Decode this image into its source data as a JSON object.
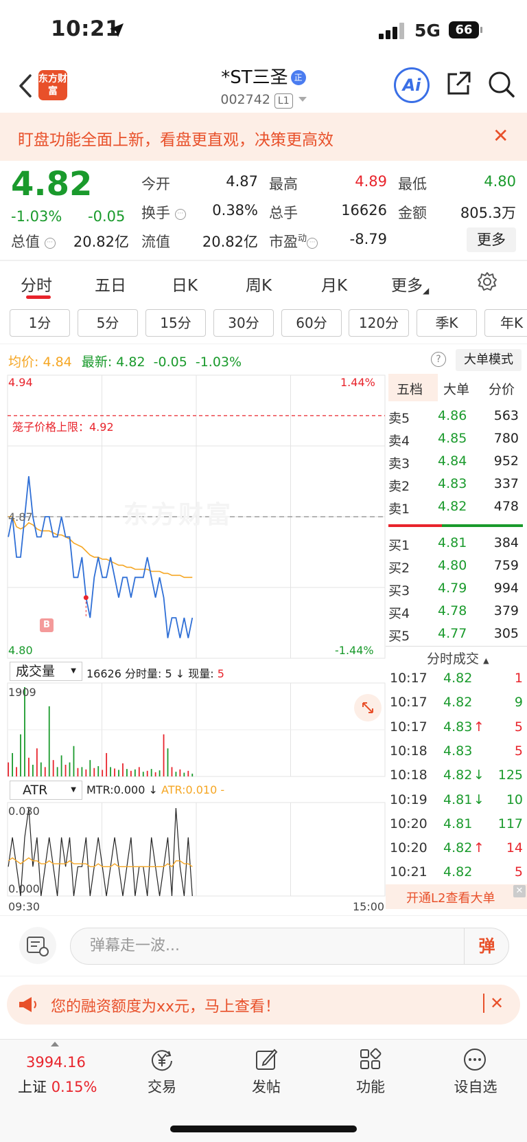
{
  "status_bar": {
    "time": "10:21",
    "network": "5G",
    "battery": "66"
  },
  "header": {
    "logo_text": "东方财富",
    "title": "*ST三圣",
    "title_badge": "正",
    "code": "002742",
    "level": "L1",
    "ai_label": "Ai"
  },
  "promo": {
    "text": "盯盘功能全面上新，看盘更直观，决策更高效",
    "close": "✕"
  },
  "quote": {
    "price": "4.82",
    "pct": "-1.03%",
    "change": "-0.05",
    "fields": [
      {
        "label": "今开",
        "value": "4.87",
        "color": "#222222"
      },
      {
        "label": "最高",
        "value": "4.89",
        "color": "#e8242c"
      },
      {
        "label": "最低",
        "value": "4.80",
        "color": "#1a9a2c"
      },
      {
        "label": "换手",
        "value": "0.38%",
        "color": "#222222"
      },
      {
        "label": "总手",
        "value": "16626",
        "color": "#222222"
      },
      {
        "label": "金额",
        "value": "805.3万",
        "color": "#222222"
      },
      {
        "label": "总值",
        "value": "20.82亿",
        "color": "#222222"
      },
      {
        "label": "流值",
        "value": "20.82亿",
        "color": "#222222"
      },
      {
        "label": "市盈",
        "value": "-8.79",
        "color": "#222222"
      }
    ],
    "pe_sup": "动",
    "more_label": "更多"
  },
  "tabs": [
    "分时",
    "五日",
    "日K",
    "周K",
    "月K",
    "更多"
  ],
  "periods": [
    "1分",
    "5分",
    "15分",
    "30分",
    "60分",
    "120分",
    "季K",
    "年K"
  ],
  "avg_bar": {
    "avg_label": "均价:",
    "avg_value": "4.84",
    "latest_label": "最新:",
    "latest_value": "4.82",
    "change": "-0.05",
    "pct": "-1.03%"
  },
  "big_order_label": "大单模式",
  "chart_data": {
    "type": "line",
    "price_high": "4.94",
    "price_low": "4.80",
    "pct_high": "1.44%",
    "pct_low": "-1.44%",
    "prev_close": "4.87",
    "limit_label": "笼子价格上限：4.92",
    "limit_value": 4.92,
    "ylim": [
      4.8,
      4.94
    ],
    "time_start": "09:30",
    "time_end": "15:00",
    "price": [
      4.86,
      4.87,
      4.85,
      4.85,
      4.87,
      4.89,
      4.87,
      4.86,
      4.86,
      4.87,
      4.87,
      4.86,
      4.86,
      4.87,
      4.86,
      4.86,
      4.84,
      4.84,
      4.85,
      4.83,
      4.82,
      4.84,
      4.85,
      4.84,
      4.84,
      4.85,
      4.84,
      4.83,
      4.84,
      4.84,
      4.83,
      4.84,
      4.84,
      4.84,
      4.85,
      4.84,
      4.83,
      4.84,
      4.83,
      4.81,
      4.82,
      4.82,
      4.81,
      4.82,
      4.81,
      4.82
    ],
    "avg": [
      4.87,
      4.87,
      4.865,
      4.864,
      4.865,
      4.867,
      4.866,
      4.864,
      4.863,
      4.863,
      4.863,
      4.862,
      4.861,
      4.861,
      4.86,
      4.859,
      4.857,
      4.856,
      4.855,
      4.853,
      4.851,
      4.85,
      4.85,
      4.849,
      4.849,
      4.848,
      4.847,
      4.846,
      4.846,
      4.845,
      4.845,
      4.844,
      4.844,
      4.844,
      4.844,
      4.843,
      4.843,
      4.843,
      4.842,
      4.842,
      4.841,
      4.841,
      4.841,
      4.84,
      4.84,
      4.84
    ],
    "buy_marker": "B",
    "volume_label": "成交量",
    "volume_total": "16626",
    "volume_minute_label": "分时量:",
    "volume_minute": "5",
    "volume_now_label": "现量:",
    "volume_now": "5",
    "volume_max": "1909",
    "volume": [
      300,
      500,
      200,
      900,
      1909,
      400,
      250,
      600,
      300,
      200,
      1500,
      350,
      200,
      450,
      250,
      300,
      650,
      180,
      200,
      150,
      350,
      180,
      220,
      140,
      500,
      200,
      170,
      140,
      280,
      160,
      120,
      150,
      200,
      100,
      120,
      160,
      90,
      130,
      900,
      600,
      200,
      100,
      150,
      80,
      120,
      60
    ],
    "volume_colors": [
      "r",
      "g",
      "r",
      "g",
      "g",
      "r",
      "g",
      "r",
      "g",
      "r",
      "g",
      "r",
      "g",
      "g",
      "r",
      "g",
      "g",
      "r",
      "g",
      "r",
      "g",
      "r",
      "g",
      "r",
      "r",
      "g",
      "r",
      "g",
      "r",
      "g",
      "r",
      "g",
      "r",
      "g",
      "r",
      "g",
      "r",
      "g",
      "r",
      "g",
      "r",
      "g",
      "r",
      "g",
      "r",
      "g"
    ],
    "atr_label": "ATR",
    "mtr_text": "MTR:0.000",
    "atr_text": "ATR:0.010",
    "atr_top": "0.030",
    "atr_bottom": "0.000",
    "mtr": [
      0.01,
      0.02,
      0.01,
      0.0,
      0.02,
      0.03,
      0.01,
      0.02,
      0.0,
      0.01,
      0.02,
      0.01,
      0.0,
      0.02,
      0.01,
      0.02,
      0.0,
      0.01,
      0.01,
      0.02,
      0.0,
      0.01,
      0.02,
      0.01,
      0.0,
      0.01,
      0.02,
      0.01,
      0.0,
      0.01,
      0.02,
      0.0,
      0.01,
      0.01,
      0.0,
      0.02,
      0.01,
      0.0,
      0.01,
      0.02,
      0.0,
      0.03,
      0.01,
      0.0,
      0.02,
      0.0
    ],
    "atr": [
      0.012,
      0.013,
      0.012,
      0.011,
      0.012,
      0.013,
      0.012,
      0.012,
      0.011,
      0.011,
      0.012,
      0.011,
      0.011,
      0.011,
      0.011,
      0.012,
      0.011,
      0.011,
      0.011,
      0.011,
      0.01,
      0.01,
      0.011,
      0.01,
      0.01,
      0.01,
      0.011,
      0.01,
      0.01,
      0.01,
      0.01,
      0.01,
      0.01,
      0.01,
      0.01,
      0.01,
      0.01,
      0.01,
      0.01,
      0.011,
      0.01,
      0.012,
      0.012,
      0.011,
      0.011,
      0.01
    ]
  },
  "order_book": {
    "tabs": [
      "五档",
      "大单",
      "分价"
    ],
    "sell": [
      {
        "label": "卖5",
        "price": "4.86",
        "vol": "563"
      },
      {
        "label": "卖4",
        "price": "4.85",
        "vol": "780"
      },
      {
        "label": "卖3",
        "price": "4.84",
        "vol": "952"
      },
      {
        "label": "卖2",
        "price": "4.83",
        "vol": "337"
      },
      {
        "label": "卖1",
        "price": "4.82",
        "vol": "478"
      }
    ],
    "buy": [
      {
        "label": "买1",
        "price": "4.81",
        "vol": "384"
      },
      {
        "label": "买2",
        "price": "4.80",
        "vol": "759"
      },
      {
        "label": "买3",
        "price": "4.79",
        "vol": "994"
      },
      {
        "label": "买4",
        "price": "4.78",
        "vol": "379"
      },
      {
        "label": "买5",
        "price": "4.77",
        "vol": "305"
      }
    ],
    "buy_sell_ratio": 0.4
  },
  "trades": {
    "title": "分时成交",
    "rows": [
      {
        "time": "10:17",
        "price": "4.82",
        "arrow": "",
        "vol": "1",
        "vc": "#e8242c"
      },
      {
        "time": "10:17",
        "price": "4.82",
        "arrow": "",
        "vol": "9",
        "vc": "#1a9a2c"
      },
      {
        "time": "10:17",
        "price": "4.83",
        "arrow": "↑",
        "vol": "5",
        "vc": "#e8242c"
      },
      {
        "time": "10:18",
        "price": "4.83",
        "arrow": "",
        "vol": "5",
        "vc": "#e8242c"
      },
      {
        "time": "10:18",
        "price": "4.82",
        "arrow": "↓",
        "vol": "125",
        "vc": "#1a9a2c"
      },
      {
        "time": "10:19",
        "price": "4.81",
        "arrow": "↓",
        "vol": "10",
        "vc": "#1a9a2c"
      },
      {
        "time": "10:20",
        "price": "4.81",
        "arrow": "",
        "vol": "117",
        "vc": "#1a9a2c"
      },
      {
        "time": "10:20",
        "price": "4.82",
        "arrow": "↑",
        "vol": "14",
        "vc": "#e8242c"
      },
      {
        "time": "10:21",
        "price": "4.82",
        "arrow": "",
        "vol": "5",
        "vc": "#e8242c"
      }
    ],
    "l2_text": "开通L2查看大单"
  },
  "danmu": {
    "placeholder": "弹幕走一波...",
    "send": "弹"
  },
  "margin_banner": {
    "text": "您的融资额度为xx元，马上查看！",
    "close": "✕"
  },
  "tabbar": {
    "index_value": "3994.16",
    "index_name": "上证",
    "index_pct": "0.15%",
    "items": [
      "交易",
      "发帖",
      "功能",
      "设自选"
    ]
  },
  "watermark": "东方财富",
  "colors": {
    "up": "#e8242c",
    "down": "#1a9a2c",
    "accent": "#e8502a",
    "avg": "#f5a623",
    "price_line": "#2f6fd6"
  }
}
